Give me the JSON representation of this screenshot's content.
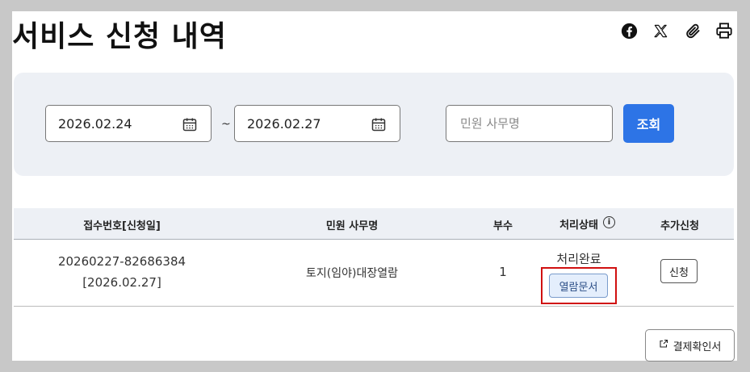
{
  "page": {
    "title": "서비스 신청 내역"
  },
  "share": {
    "icons": [
      "facebook-icon",
      "x-icon",
      "attachment-icon",
      "print-icon"
    ]
  },
  "filter": {
    "start_date": "2026.02.24",
    "separator": "~",
    "end_date": "2026.02.27",
    "keyword_placeholder": "민원 사무명",
    "search_label": "조회"
  },
  "table": {
    "headers": {
      "receipt": "접수번호[신청일]",
      "service": "민원 사무명",
      "copies": "부수",
      "status": "처리상태",
      "extra": "추가신청"
    },
    "rows": [
      {
        "receipt_no": "20260227-82686384",
        "applied_date": "[2026.02.27]",
        "service": "토지(임야)대장열람",
        "copies": "1",
        "status": "처리완료",
        "doc_button": "열람문서",
        "apply_button": "신청"
      }
    ]
  },
  "footer": {
    "payment_label": "결제확인서"
  },
  "colors": {
    "accent": "#2d74e6",
    "highlight": "#d01010",
    "panel": "#edf0f5"
  }
}
